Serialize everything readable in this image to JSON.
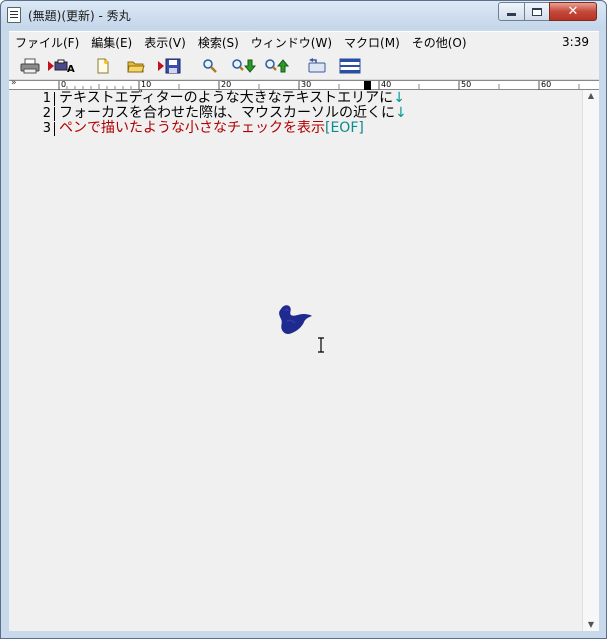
{
  "window": {
    "title": "(無題)(更新) - 秀丸"
  },
  "menubar": {
    "items": [
      {
        "label": "ファイル(F)"
      },
      {
        "label": "編集(E)"
      },
      {
        "label": "表示(V)"
      },
      {
        "label": "検索(S)"
      },
      {
        "label": "ウィンドウ(W)"
      },
      {
        "label": "マクロ(M)"
      },
      {
        "label": "その他(O)"
      }
    ],
    "clock": "3:39"
  },
  "toolbar": {
    "buttons": [
      "print-icon",
      "print-setup-icon",
      "new-file-icon",
      "open-folder-icon",
      "save-icon",
      "search-icon",
      "search-next-icon",
      "search-prev-icon",
      "replace-icon",
      "split-window-icon"
    ]
  },
  "ruler": {
    "corner": "»",
    "ticks": [
      "0",
      "10",
      "20",
      "30",
      "40",
      "50",
      "60"
    ]
  },
  "editor": {
    "lines": [
      {
        "num": "1",
        "text": "テキストエディターのような大きなテキストエリアに",
        "newline": "↓"
      },
      {
        "num": "2",
        "text": "フォーカスを合わせた際は、マウスカーソルの近くに",
        "newline": "↓"
      },
      {
        "num": "3",
        "text": "ペンで描いたような小さなチェックを表示",
        "eof": "[EOF]"
      }
    ]
  },
  "colors": {
    "ink": "#1f2a8f",
    "line3_text": "#b00000",
    "newline_mark": "#009999"
  }
}
